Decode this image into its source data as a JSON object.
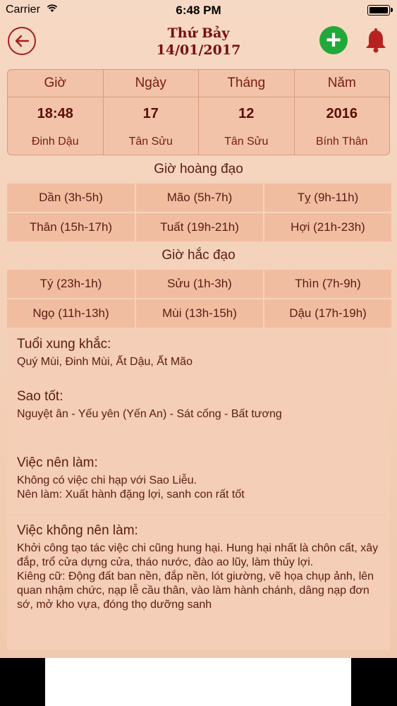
{
  "status_bar": {
    "carrier": "Carrier",
    "time": "6:48 PM"
  },
  "nav": {
    "weekday": "Thứ Bảy",
    "date": "14/01/2017"
  },
  "date_table": [
    {
      "header": "Giờ",
      "value": "18:48",
      "sub": "Đinh Dậu"
    },
    {
      "header": "Ngày",
      "value": "17",
      "sub": "Tân Sửu"
    },
    {
      "header": "Tháng",
      "value": "12",
      "sub": "Tân Sửu"
    },
    {
      "header": "Năm",
      "value": "2016",
      "sub": "Bính Thân"
    }
  ],
  "gio_hoang_dao": {
    "title": "Giờ hoàng đạo",
    "cells": [
      "Dần (3h-5h)",
      "Mão (5h-7h)",
      "Tỵ (9h-11h)",
      "Thân (15h-17h)",
      "Tuất (19h-21h)",
      "Hợi (21h-23h)"
    ]
  },
  "gio_hac_dao": {
    "title": "Giờ hắc đạo",
    "cells": [
      "Tý (23h-1h)",
      "Sửu (1h-3h)",
      "Thìn (7h-9h)",
      "Ngọ (11h-13h)",
      "Mùi (13h-15h)",
      "Dậu (17h-19h)"
    ]
  },
  "tuoi_xung_khac": {
    "title": "Tuổi xung khắc:",
    "text": "Quý Mùi, Đinh Mùi, Ất Dậu, Ất Mão"
  },
  "sao_tot": {
    "title": "Sao tốt:",
    "text": "Nguyệt ân - Yếu yên (Yến An) - Sát cống - Bất tương"
  },
  "viec_nen_lam": {
    "title": "Việc nên làm:",
    "line1": "Không có việc chi hạp với Sao Liễu.",
    "line2": "Nên làm: Xuất hành đặng lợi, sanh con rất tốt"
  },
  "viec_khong_nen_lam": {
    "title": "Việc không nên làm:",
    "line1": "Khởi công tạo tác việc chi cũng hung hại. Hung hại nhất là chôn cất, xây đắp, trổ cửa dựng cửa, tháo nước, đào ao lũy, làm thủy lợi.",
    "line2": "Kiêng cữ: Động đất ban nền, đắp nền, lót giường, vẽ họa chụp ảnh, lên quan nhậm chức, nạp lễ cầu thân, vào làm hành chánh, dâng nạp đơn sớ, mở kho vựa, đóng thọ dưỡng sanh"
  },
  "colors": {
    "accent": "#a31f1f",
    "add": "#22a83a",
    "text": "#5a1c12"
  }
}
